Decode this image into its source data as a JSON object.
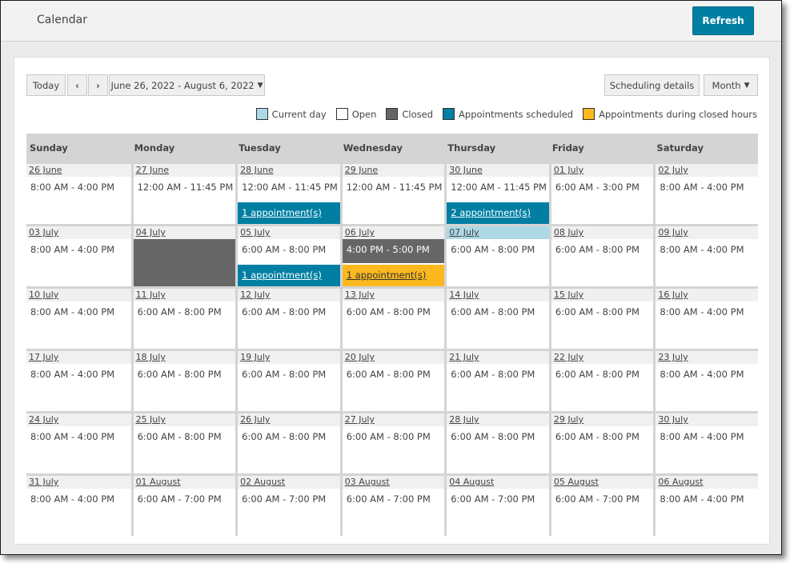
{
  "header": {
    "title": "Calendar",
    "refresh_label": "Refresh"
  },
  "toolbar": {
    "today_label": "Today",
    "prev_icon": "chevron-left-icon",
    "next_icon": "chevron-right-icon",
    "date_range": "June 26, 2022 - August 6, 2022",
    "scheduling_details_label": "Scheduling details",
    "view_label": "Month"
  },
  "legend": [
    {
      "label": "Current day",
      "color": "#add8e6"
    },
    {
      "label": "Open",
      "color": "#ffffff"
    },
    {
      "label": "Closed",
      "color": "#666666"
    },
    {
      "label": "Appointments scheduled",
      "color": "#007fa3"
    },
    {
      "label": "Appointments during closed hours",
      "color": "#fbb81f"
    }
  ],
  "weekdays": [
    "Sunday",
    "Monday",
    "Tuesday",
    "Wednesday",
    "Thursday",
    "Friday",
    "Saturday"
  ],
  "weeks": [
    [
      {
        "date": "26 June",
        "hours": "8:00 AM - 4:00 PM"
      },
      {
        "date": "27 June",
        "hours": "12:00 AM - 11:45 PM"
      },
      {
        "date": "28 June",
        "hours": "12:00 AM - 11:45 PM",
        "appointments": "1 appointment(s)",
        "appt_type": "scheduled"
      },
      {
        "date": "29 June",
        "hours": "12:00 AM - 11:45 PM"
      },
      {
        "date": "30 June",
        "hours": "12:00 AM - 11:45 PM",
        "appointments": "2 appointment(s)",
        "appt_type": "scheduled"
      },
      {
        "date": "01 July",
        "hours": "6:00 AM - 3:00 PM"
      },
      {
        "date": "02 July",
        "hours": "8:00 AM - 4:00 PM"
      }
    ],
    [
      {
        "date": "03 July",
        "hours": "8:00 AM - 4:00 PM"
      },
      {
        "date": "04 July",
        "hours": "",
        "status": "closed"
      },
      {
        "date": "05 July",
        "hours": "6:00 AM - 8:00 PM",
        "appointments": "1 appointment(s)",
        "appt_type": "scheduled"
      },
      {
        "date": "06 July",
        "hours": "4:00 PM - 5:00 PM",
        "status": "closed-hours",
        "appointments": "1 appointment(s)",
        "appt_type": "closed-hours"
      },
      {
        "date": "07 July",
        "hours": "6:00 AM - 8:00 PM",
        "current": true
      },
      {
        "date": "08 July",
        "hours": "6:00 AM - 8:00 PM"
      },
      {
        "date": "09 July",
        "hours": "8:00 AM - 4:00 PM"
      }
    ],
    [
      {
        "date": "10 July",
        "hours": "8:00 AM - 4:00 PM"
      },
      {
        "date": "11 July",
        "hours": "6:00 AM - 8:00 PM"
      },
      {
        "date": "12 July",
        "hours": "6:00 AM - 8:00 PM"
      },
      {
        "date": "13 July",
        "hours": "6:00 AM - 8:00 PM"
      },
      {
        "date": "14 July",
        "hours": "6:00 AM - 8:00 PM"
      },
      {
        "date": "15 July",
        "hours": "6:00 AM - 8:00 PM"
      },
      {
        "date": "16 July",
        "hours": "8:00 AM - 4:00 PM"
      }
    ],
    [
      {
        "date": "17 July",
        "hours": "8:00 AM - 4:00 PM"
      },
      {
        "date": "18 July",
        "hours": "6:00 AM - 8:00 PM"
      },
      {
        "date": "19 July",
        "hours": "6:00 AM - 8:00 PM"
      },
      {
        "date": "20 July",
        "hours": "6:00 AM - 8:00 PM"
      },
      {
        "date": "21 July",
        "hours": "6:00 AM - 8:00 PM"
      },
      {
        "date": "22 July",
        "hours": "6:00 AM - 8:00 PM"
      },
      {
        "date": "23 July",
        "hours": "8:00 AM - 4:00 PM"
      }
    ],
    [
      {
        "date": "24 July",
        "hours": "8:00 AM - 4:00 PM"
      },
      {
        "date": "25 July",
        "hours": "6:00 AM - 8:00 PM"
      },
      {
        "date": "26 July",
        "hours": "6:00 AM - 8:00 PM"
      },
      {
        "date": "27 July",
        "hours": "6:00 AM - 8:00 PM"
      },
      {
        "date": "28 July",
        "hours": "6:00 AM - 8:00 PM"
      },
      {
        "date": "29 July",
        "hours": "6:00 AM - 8:00 PM"
      },
      {
        "date": "30 July",
        "hours": "8:00 AM - 4:00 PM"
      }
    ],
    [
      {
        "date": "31 July",
        "hours": "8:00 AM - 4:00 PM"
      },
      {
        "date": "01 August",
        "hours": "6:00 AM - 7:00 PM"
      },
      {
        "date": "02 August",
        "hours": "6:00 AM - 7:00 PM"
      },
      {
        "date": "03 August",
        "hours": "6:00 AM - 7:00 PM"
      },
      {
        "date": "04 August",
        "hours": "6:00 AM - 7:00 PM"
      },
      {
        "date": "05 August",
        "hours": "6:00 AM - 7:00 PM"
      },
      {
        "date": "06 August",
        "hours": "8:00 AM - 4:00 PM"
      }
    ]
  ]
}
